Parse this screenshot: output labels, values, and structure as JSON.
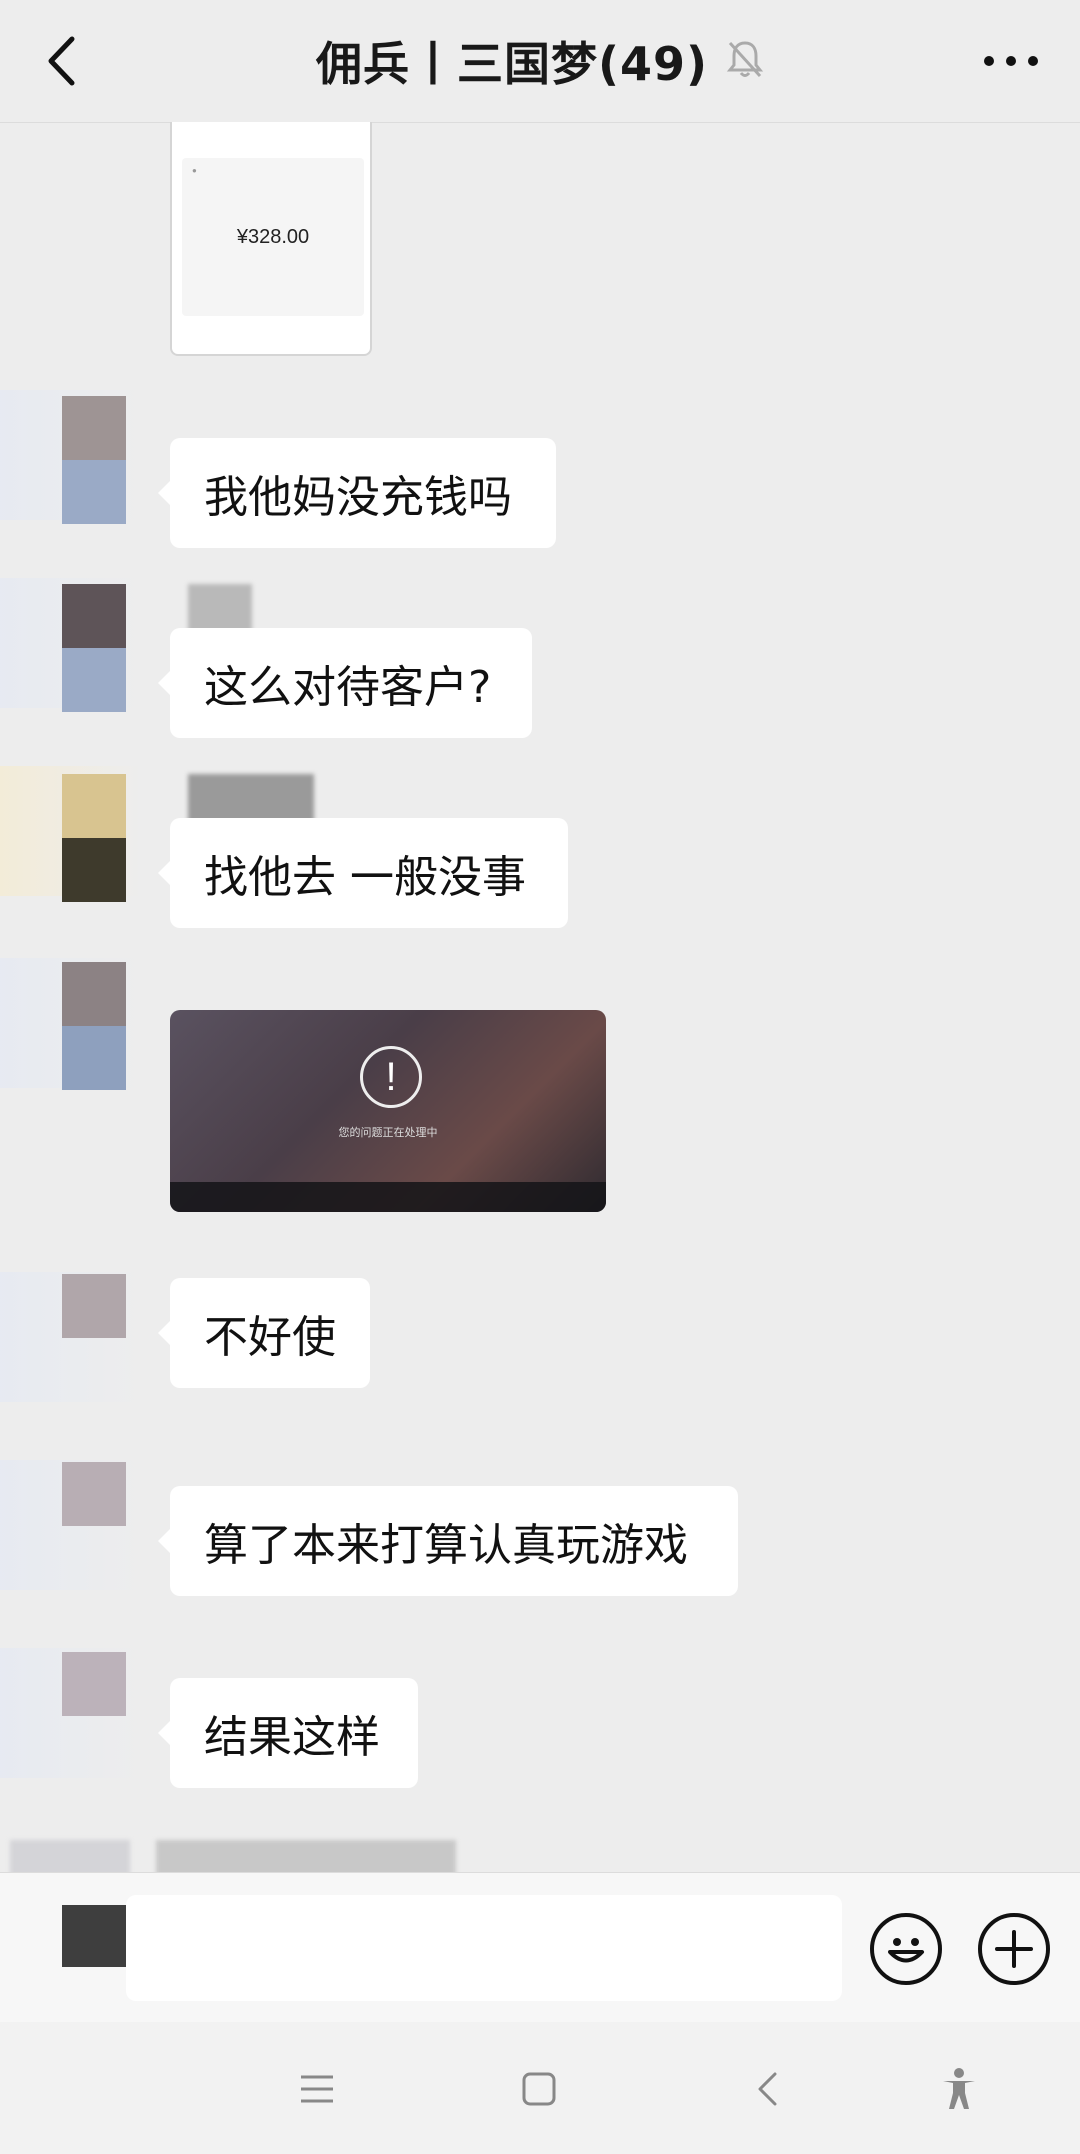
{
  "header": {
    "title": "佣兵丨三国梦(49)",
    "icons": [
      "back-icon",
      "mute-bell-icon",
      "more-icon"
    ]
  },
  "receipt": {
    "amount": "¥328.00"
  },
  "messages": [
    {
      "type": "text",
      "text": "我他妈没充钱吗"
    },
    {
      "type": "text",
      "text": "这么对待客户?"
    },
    {
      "type": "text",
      "text": "找他去 一般没事"
    },
    {
      "type": "image",
      "caption": "您的问题正在处理中"
    },
    {
      "type": "text",
      "text": "不好使"
    },
    {
      "type": "text",
      "text": "算了本来打算认真玩游戏"
    },
    {
      "type": "text",
      "text": "结果这样"
    }
  ],
  "composer": {
    "icons": [
      "emoji-icon",
      "plus-icon"
    ]
  },
  "navbar": {
    "icons": [
      "menu-icon",
      "home-icon",
      "back-nav-icon",
      "accessibility-icon"
    ]
  },
  "colors": {
    "background": "#ededed",
    "bubble": "#ffffff",
    "text": "#191919"
  }
}
